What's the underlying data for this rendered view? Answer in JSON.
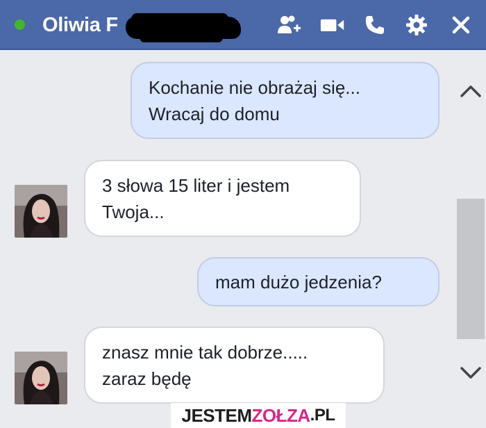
{
  "header": {
    "contact_name": "Oliwia F",
    "online": true,
    "icons": [
      "add-people-icon",
      "video-call-icon",
      "phone-icon",
      "gear-icon",
      "close-icon"
    ],
    "accent_color": "#4b68a8",
    "status_color": "#42b72a"
  },
  "messages": [
    {
      "direction": "outgoing",
      "text": "Kochanie nie obrażaj się...\nWracaj do domu"
    },
    {
      "direction": "incoming",
      "text": "3 słowa 15 liter i jestem\nTwoja..."
    },
    {
      "direction": "outgoing",
      "text": "mam dużo jedzenia?"
    },
    {
      "direction": "incoming",
      "text": "znasz mnie tak dobrze.....\nzaraz będę"
    }
  ],
  "scrollbar": {
    "icons": [
      "chevron-up-icon",
      "chevron-down-icon"
    ]
  },
  "watermark": {
    "part1": "JESTEM",
    "part2": "ZOŁZA",
    "part3": ".PL"
  }
}
